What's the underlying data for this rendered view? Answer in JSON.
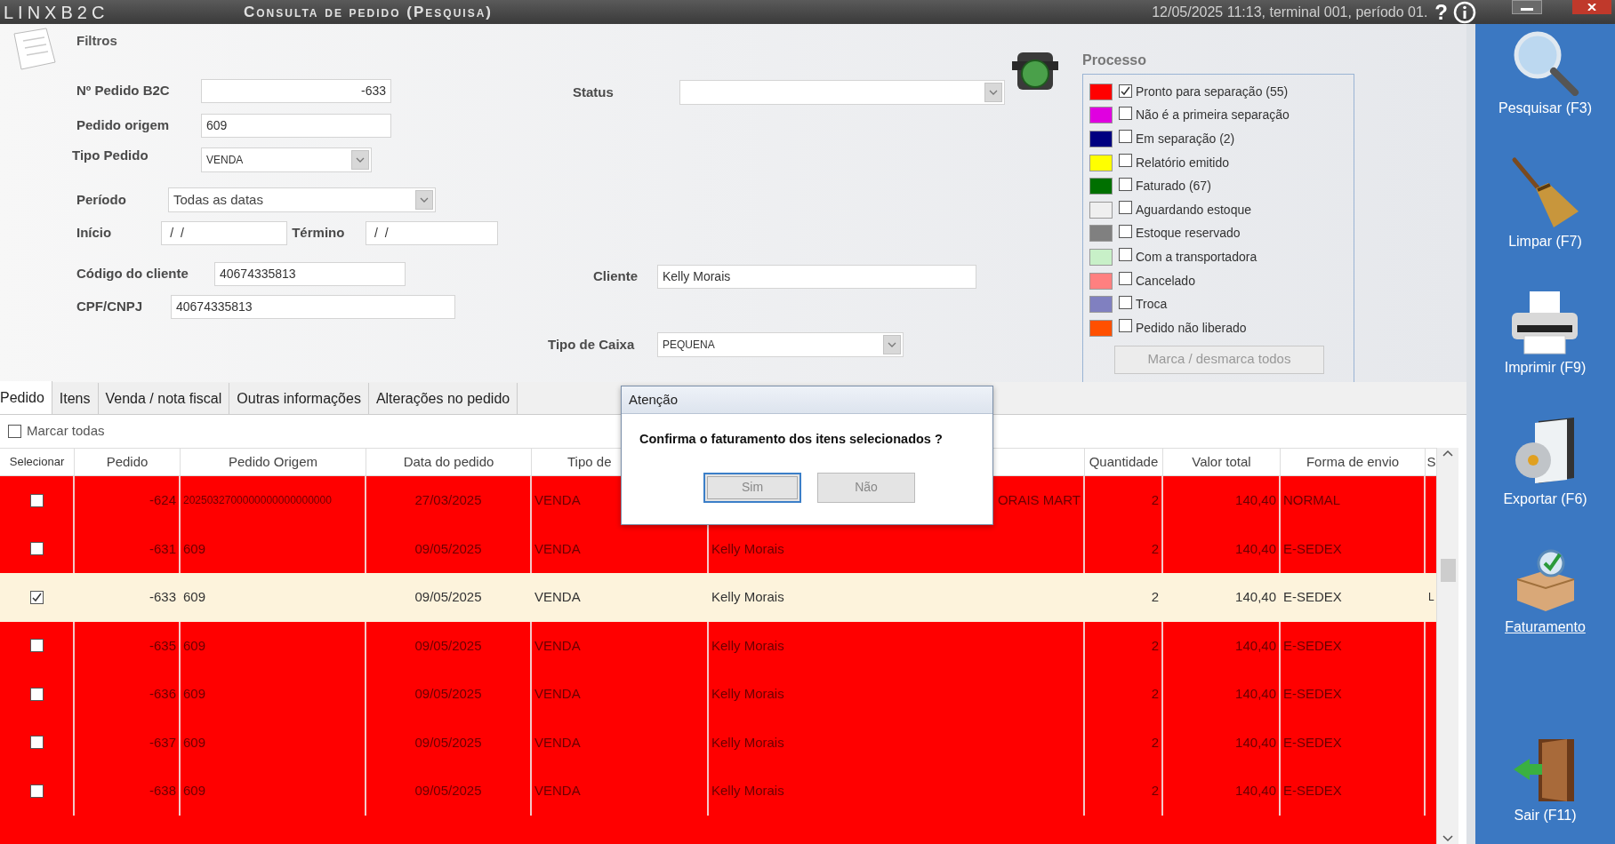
{
  "titlebar": {
    "logo": "LINXB2C",
    "title": "Consulta de pedido (Pesquisa)",
    "session": "12/05/2025 11:13, terminal 001, período 01.",
    "help": "?"
  },
  "filters": {
    "heading": "Filtros",
    "pedido_b2c": {
      "label": "Nº Pedido B2C",
      "value": "-633"
    },
    "pedido_origem": {
      "label": "Pedido origem",
      "value": "609"
    },
    "tipo_pedido": {
      "label": "Tipo Pedido",
      "value": "VENDA"
    },
    "periodo": {
      "label": "Período",
      "value": "Todas as datas"
    },
    "inicio": {
      "label": "Início",
      "value": " /  /"
    },
    "termino": {
      "label": "Término",
      "value": " /  /"
    },
    "codigo_cliente": {
      "label": "Código do cliente",
      "value": "40674335813"
    },
    "cpf_cnpj": {
      "label": "CPF/CNPJ",
      "value": "40674335813"
    },
    "status": {
      "label": "Status"
    },
    "cliente": {
      "label": "Cliente",
      "value": "Kelly Morais"
    },
    "tipo_caixa": {
      "label": "Tipo de Caixa",
      "value": "PEQUENA"
    }
  },
  "process": {
    "title": "Processo",
    "button": "Marca / desmarca todos",
    "items": [
      {
        "label": "Pronto para separação (55)",
        "color": "#ff0000",
        "checked": true
      },
      {
        "label": "Não é a primeira separação",
        "color": "#e000e0",
        "checked": false
      },
      {
        "label": "Em separação (2)",
        "color": "#000080",
        "checked": false
      },
      {
        "label": "Relatório emitido",
        "color": "#ffff00",
        "checked": false
      },
      {
        "label": "Faturado (67)",
        "color": "#007000",
        "checked": false
      },
      {
        "label": "Aguardando estoque",
        "color": "#efefef",
        "checked": false
      },
      {
        "label": "Estoque reservado",
        "color": "#808080",
        "checked": false
      },
      {
        "label": "Com a transportadora",
        "color": "#c8f0c8",
        "checked": false
      },
      {
        "label": "Cancelado",
        "color": "#ff8080",
        "checked": false
      },
      {
        "label": "Troca",
        "color": "#8080c0",
        "checked": false
      },
      {
        "label": "Pedido não liberado",
        "color": "#ff5000",
        "checked": false
      }
    ]
  },
  "tabs": [
    {
      "label": "Pedido",
      "selected": true
    },
    {
      "label": "Itens",
      "selected": false
    },
    {
      "label": "Venda / nota fiscal",
      "selected": false
    },
    {
      "label": "Outras informações",
      "selected": false
    },
    {
      "label": "Alterações no pedido",
      "selected": false
    }
  ],
  "mark_all": {
    "label": "Marcar todas",
    "checked": false
  },
  "table": {
    "select_column": "Selecionar",
    "columns": [
      "Pedido",
      "Pedido Origem",
      "Data do pedido",
      "Tipo de",
      "",
      "Quantidade",
      "Valor total",
      "Forma de envio",
      "S"
    ],
    "rows": [
      {
        "selected": false,
        "checked": false,
        "cells": [
          "-624",
          "2025032700000000000000000",
          "27/03/2025",
          "VENDA",
          "ORAIS MART",
          "2",
          "140,40",
          "NORMAL",
          ""
        ]
      },
      {
        "selected": false,
        "checked": false,
        "cells": [
          "-631",
          "609",
          "09/05/2025",
          "VENDA",
          "Kelly Morais",
          "2",
          "140,40",
          "E-SEDEX",
          ""
        ]
      },
      {
        "selected": true,
        "checked": true,
        "cells": [
          "-633",
          "609",
          "09/05/2025",
          "VENDA",
          "Kelly Morais",
          "2",
          "140,40",
          "E-SEDEX",
          "L"
        ]
      },
      {
        "selected": false,
        "checked": false,
        "cells": [
          "-635",
          "609",
          "09/05/2025",
          "VENDA",
          "Kelly Morais",
          "2",
          "140,40",
          "E-SEDEX",
          ""
        ]
      },
      {
        "selected": false,
        "checked": false,
        "cells": [
          "-636",
          "609",
          "09/05/2025",
          "VENDA",
          "Kelly Morais",
          "2",
          "140,40",
          "E-SEDEX",
          ""
        ]
      },
      {
        "selected": false,
        "checked": false,
        "cells": [
          "-637",
          "609",
          "09/05/2025",
          "VENDA",
          "Kelly Morais",
          "2",
          "140,40",
          "E-SEDEX",
          ""
        ]
      },
      {
        "selected": false,
        "checked": false,
        "cells": [
          "-638",
          "609",
          "09/05/2025",
          "VENDA",
          "Kelly Morais",
          "2",
          "140,40",
          "E-SEDEX",
          ""
        ]
      }
    ]
  },
  "dialog": {
    "title": "Atenção",
    "message": "Confirma o faturamento dos itens selecionados ?",
    "buttons": [
      {
        "label": "Sim",
        "focused": true
      },
      {
        "label": "Não",
        "focused": false
      }
    ]
  },
  "sidebar": [
    {
      "kind": "search",
      "label": "Pesquisar (F3)",
      "hovered": false
    },
    {
      "kind": "broom",
      "label": "Limpar (F7)",
      "hovered": false
    },
    {
      "kind": "printer",
      "label": "Imprimir (F9)",
      "hovered": false
    },
    {
      "kind": "disc",
      "label": "Exportar (F6)",
      "hovered": false
    },
    {
      "kind": "box",
      "label": "Faturamento",
      "hovered": true
    },
    {
      "kind": "door",
      "label": "Sair (F11)",
      "hovered": false
    }
  ]
}
